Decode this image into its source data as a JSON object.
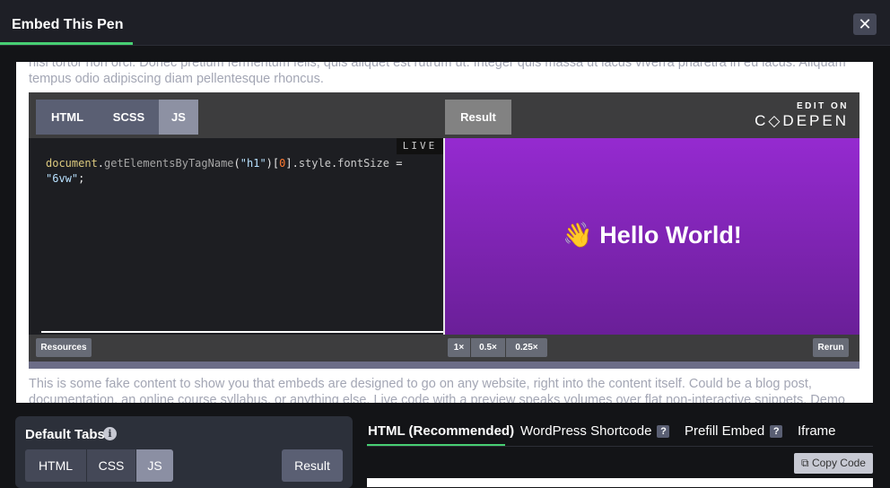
{
  "header": {
    "title": "Embed This Pen",
    "close_label": "✕"
  },
  "preview": {
    "text_top_line1": "nisl tortor non orci. Donec pretium fermentum felis, quis aliquet est rutrum ut. Integer quis massa ut lacus viverra pharetra in eu lacus. Aliquam",
    "text_top_line2": "tempus odio adipiscing diam pellentesque rhoncus.",
    "text_bottom_line1": "This is some fake content to show you that embeds are designed to go on any website, right into the content itself. Could be a blog post,",
    "text_bottom_line2": "documentation, an online course syllabus, or anything else. Live code with a preview speaks volumes over flat non-interactive snippets. Demo"
  },
  "embed": {
    "tabs": [
      "HTML",
      "SCSS",
      "JS"
    ],
    "active_tab": "JS",
    "result_label": "Result",
    "edit_on": "EDIT ON",
    "brand": "C◇DEPEN",
    "live": "LIVE",
    "code": {
      "obj": "document",
      "dot1": ".",
      "fn": "getElementsByTagName",
      "paren_open": "(",
      "arg": "\"h1\"",
      "paren_close": ")[",
      "index": "0",
      "bracket_close": "].",
      "prop1": "style",
      "dot2": ".",
      "prop2": "fontSize",
      "eq": " =",
      "value": "\"6vw\"",
      "semi": ";"
    },
    "result_text": "👋 Hello World!",
    "resources": "Resources",
    "zoom": [
      "1×",
      "0.5×",
      "0.25×"
    ],
    "rerun": "Rerun"
  },
  "settings": {
    "default_tabs_label": "Default Tabs",
    "info_icon": "i",
    "options": [
      "HTML",
      "CSS",
      "JS"
    ],
    "active": "JS",
    "result": "Result"
  },
  "embed_types": {
    "tabs": [
      "HTML (Recommended)",
      "WordPress Shortcode",
      "Prefill Embed",
      "Iframe"
    ],
    "help": "?",
    "copy_label": "Copy Code",
    "copy_icon": "⧉"
  }
}
